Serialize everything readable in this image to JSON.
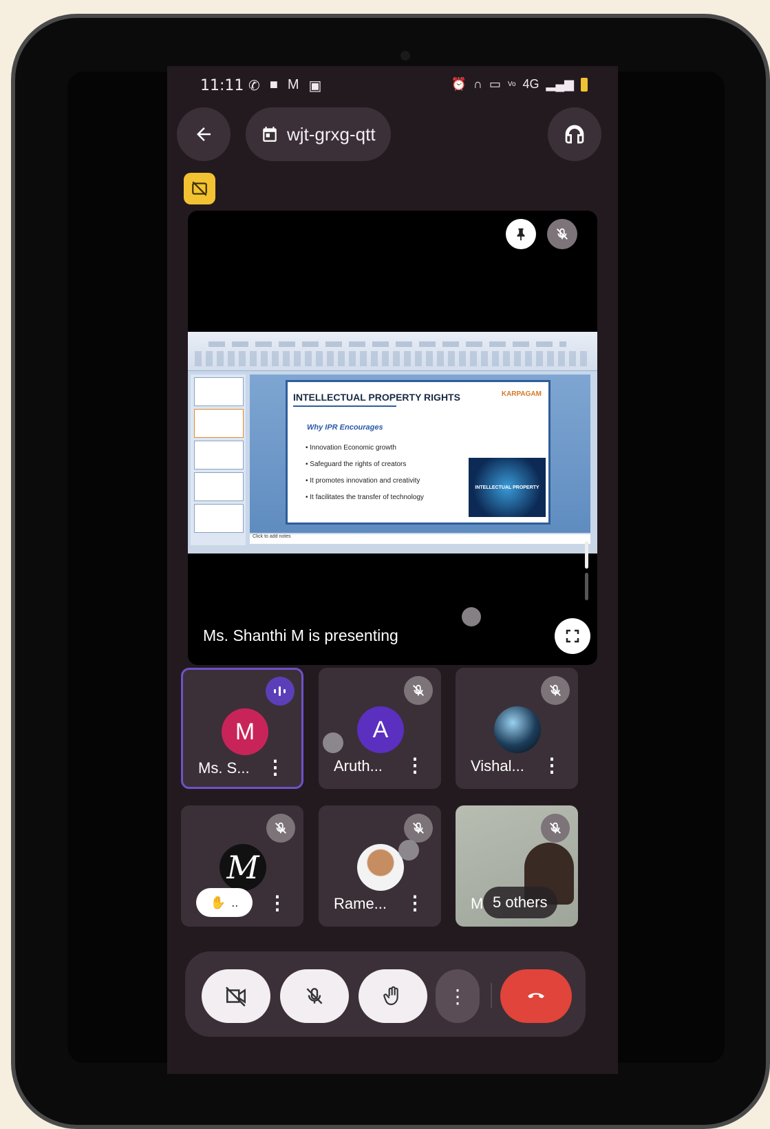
{
  "status_bar": {
    "time": "11:11",
    "left_icons": [
      "whatsapp-icon",
      "video-icon",
      "gmail-icon",
      "notification-icon"
    ],
    "right_icons": [
      "alarm-icon",
      "headphones-icon",
      "cast-icon",
      "volte-icon",
      "4g-signal-icon",
      "battery-icon"
    ],
    "network": "4G"
  },
  "top_bar": {
    "meeting_code": "wjt-grxg-qtt"
  },
  "stage": {
    "presenter_text": "Ms. Shanthi M is presenting",
    "slide": {
      "title": "INTELLECTUAL PROPERTY RIGHTS",
      "logo_text": "KARPAGAM",
      "subtitle": "Why IPR Encourages",
      "bullets": [
        "• Innovation Economic growth",
        "• Safeguard the rights of creators",
        "• It promotes innovation and creativity",
        "• It facilitates the transfer of technology"
      ],
      "image_caption": "INTELLECTUAL PROPERTY",
      "notes_placeholder": "Click to add notes"
    }
  },
  "participants": [
    {
      "name": "Ms. S...",
      "initial": "M",
      "avatar_color": "#c8245a",
      "state": "speaking"
    },
    {
      "name": "Aruth...",
      "initial": "A",
      "avatar_color": "#5b2fbf",
      "state": "muted"
    },
    {
      "name": "Vishal...",
      "initial": "",
      "state": "muted"
    },
    {
      "name": "",
      "initial": "M",
      "state": "muted",
      "hand_raised": true,
      "hand_label": ".."
    },
    {
      "name": "Rame...",
      "initial": "",
      "state": "muted"
    },
    {
      "name": "M",
      "others_label": "5 others",
      "state": "muted"
    }
  ],
  "controls": {
    "camera": "camera-off",
    "mic": "mic-off",
    "raise_hand": "raise-hand",
    "more": "more",
    "end": "end-call"
  },
  "colors": {
    "screen_bg": "#231a20",
    "tile_bg": "#3b3037",
    "active_border": "#6e52c8",
    "end_call": "#e0443a",
    "badge": "#f2c232"
  }
}
